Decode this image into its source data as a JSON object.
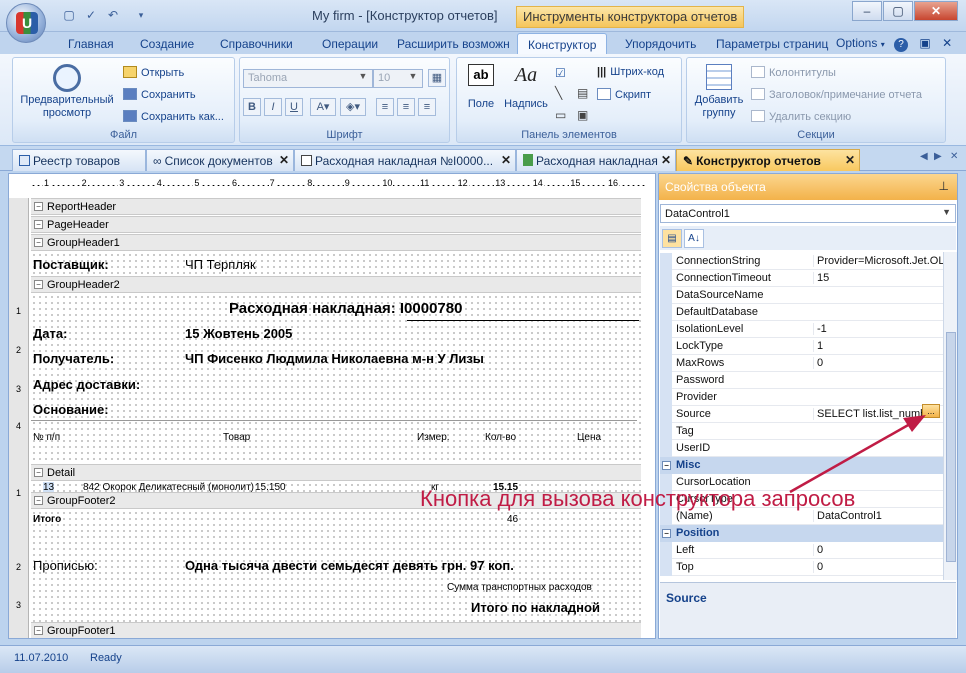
{
  "titlebar": {
    "title": "My firm - [Конструктор отчетов]",
    "contextual_tools": "Инструменты конструктора отчетов",
    "logo_letter": "U"
  },
  "ribbon_tabs": [
    "Главная",
    "Создание",
    "Справочники",
    "Операции",
    "Расширить возможн",
    "Конструктор",
    "Упорядочить",
    "Параметры страниц"
  ],
  "ribbon_tabs_active": "Конструктор",
  "options_label": "Options",
  "ribbon": {
    "file": {
      "label": "Файл",
      "preview": "Предварительный просмотр",
      "open": "Открыть",
      "save": "Сохранить",
      "save_as": "Сохранить как..."
    },
    "font": {
      "label": "Шрифт",
      "font_name": "Tahoma",
      "font_size": "10",
      "bold": "B",
      "italic": "I",
      "underline": "U"
    },
    "elements": {
      "label": "Панель элементов",
      "field": "Поле",
      "caption": "Надпись",
      "barcode": "Штрих-код",
      "script": "Скрипт"
    },
    "sections": {
      "label": "Секции",
      "add_group": "Добавить группу",
      "footers": "Колонтитулы",
      "header_note": "Заголовок/примечание отчета",
      "delete_section": "Удалить секцию"
    }
  },
  "doc_tabs": [
    "Реестр товаров",
    "Список документов",
    "Расходная накладная №I0000...",
    "Расходная накладная",
    "Конструктор отчетов"
  ],
  "designer": {
    "ruler_numbers": [
      "1",
      "2",
      "3",
      "4",
      "5",
      "6",
      "7",
      "8",
      "9",
      "10",
      "11",
      "12",
      "13",
      "14",
      "15",
      "16"
    ],
    "left_numbers": [
      "1",
      "2",
      "3",
      "4",
      "1",
      "2",
      "3"
    ],
    "bands": {
      "report_header": "ReportHeader",
      "page_header": "PageHeader",
      "group_header1": "GroupHeader1",
      "group_header2": "GroupHeader2",
      "detail": "Detail",
      "group_footer2": "GroupFooter2",
      "group_footer1": "GroupFooter1"
    },
    "supplier_label": "Поставщик:",
    "supplier_value": "ЧП Терпляк",
    "invoice_title": "Расходная накладная: I0000780",
    "date_label": "Дата:",
    "date_value": "15 Жовтень 2005",
    "recipient_label": "Получатель:",
    "recipient_value": "ЧП Фисенко Людмила Николаевна  м-н У Лизы",
    "address_label": "Адрес доставки:",
    "basis_label": "Основание:",
    "col_num": "№ п/п",
    "col_goods": "Товар",
    "col_unit": "Измер.",
    "col_qty": "Кол-во",
    "col_price": "Цена",
    "detail_num": "13",
    "detail_item": "842 Окорок Деликатесный (монолит)",
    "detail_price": "15.150",
    "detail_unit": "кг",
    "detail_qty": "15.15",
    "total_label": "Итого",
    "total_value": "46",
    "words_label": "Прописью:",
    "words_value": "Одна тысяча двести семьдесят девять  грн. 97 коп.",
    "transport_label": "Сумма транспортных расходов",
    "invoice_total_label": "Итого по накладной"
  },
  "props": {
    "title": "Свойства объекта",
    "selected_object": "DataControl1",
    "rows_top": [
      {
        "name": "ConnectionString",
        "value": "Provider=Microsoft.Jet.OLE"
      },
      {
        "name": "ConnectionTimeout",
        "value": "15"
      },
      {
        "name": "DataSourceName",
        "value": ""
      },
      {
        "name": "DefaultDatabase",
        "value": ""
      },
      {
        "name": "IsolationLevel",
        "value": "-1"
      },
      {
        "name": "LockType",
        "value": "1"
      },
      {
        "name": "MaxRows",
        "value": "0"
      },
      {
        "name": "Password",
        "value": ""
      },
      {
        "name": "Provider",
        "value": ""
      },
      {
        "name": "Source",
        "value": "SELECT list.list_numbe"
      },
      {
        "name": "Tag",
        "value": ""
      },
      {
        "name": "UserID",
        "value": ""
      }
    ],
    "cat_misc": "Misc",
    "rows_misc": [
      {
        "name": "CursorLocation",
        "value": ""
      },
      {
        "name": "CursorType",
        "value": ""
      },
      {
        "name": "(Name)",
        "value": "DataControl1"
      }
    ],
    "cat_position": "Position",
    "rows_position": [
      {
        "name": "Left",
        "value": "0"
      },
      {
        "name": "Top",
        "value": "0"
      }
    ],
    "description_title": "Source",
    "ellipsis": "..."
  },
  "annotation": "Кнопка для вызова конструктора запросов",
  "status": {
    "date": "11.07.2010",
    "state": "Ready"
  },
  "colors": {
    "accent": "#15428b",
    "annotation": "#c01c45",
    "active_tab": "#f8c85f"
  }
}
